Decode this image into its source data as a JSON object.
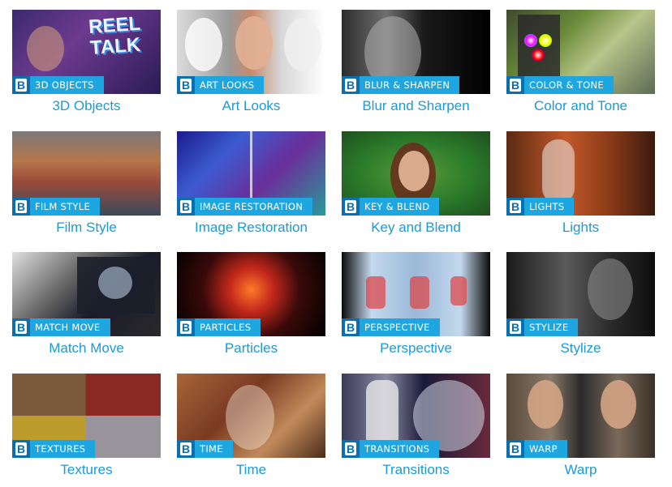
{
  "gallery": {
    "items": [
      {
        "badge": "3D OBJECTS",
        "caption": "3D Objects"
      },
      {
        "badge": "ART LOOKS",
        "caption": "Art Looks"
      },
      {
        "badge": "BLUR & SHARPEN",
        "caption": "Blur and Sharpen"
      },
      {
        "badge": "COLOR & TONE",
        "caption": "Color and Tone"
      },
      {
        "badge": "FILM STYLE",
        "caption": "Film Style"
      },
      {
        "badge": "IMAGE RESTORATION",
        "caption": "Image Restoration"
      },
      {
        "badge": "KEY & BLEND",
        "caption": "Key and Blend"
      },
      {
        "badge": "LIGHTS",
        "caption": "Lights"
      },
      {
        "badge": "MATCH MOVE",
        "caption": "Match Move"
      },
      {
        "badge": "PARTICLES",
        "caption": "Particles"
      },
      {
        "badge": "PERSPECTIVE",
        "caption": "Perspective"
      },
      {
        "badge": "STYLIZE",
        "caption": "Stylize"
      },
      {
        "badge": "TEXTURES",
        "caption": "Textures"
      },
      {
        "badge": "TIME",
        "caption": "Time"
      },
      {
        "badge": "TRANSITIONS",
        "caption": "Transitions"
      },
      {
        "badge": "WARP",
        "caption": "Warp"
      }
    ],
    "badge_logo": "B",
    "overlay_text": {
      "reel_talk": "REEL TALK"
    }
  },
  "colors": {
    "caption_blue": "#1a9ad6",
    "badge_blue": "#1ea6e0",
    "badge_logo_bg": "#0b6fae"
  }
}
